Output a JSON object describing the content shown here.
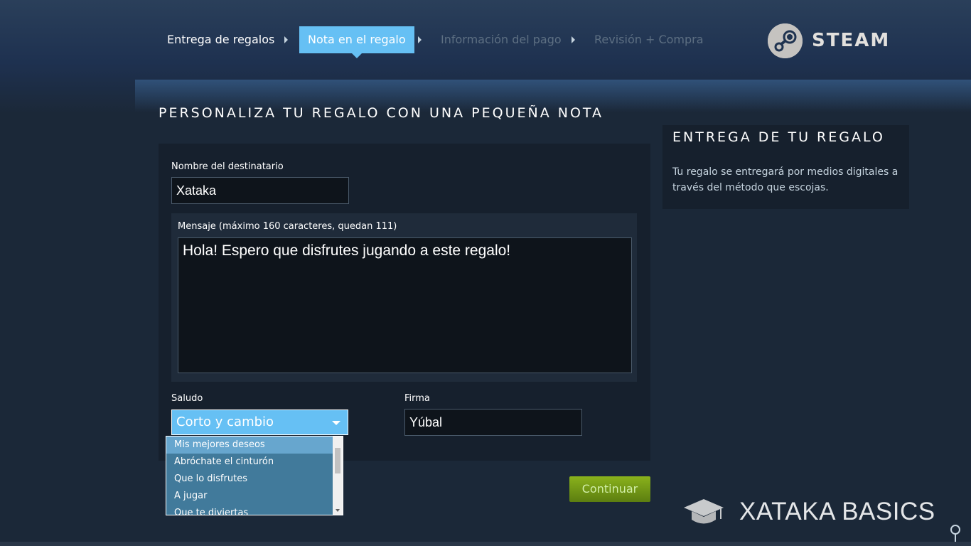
{
  "steps": [
    {
      "label": "Entrega de regalos",
      "state": "done"
    },
    {
      "label": "Nota en el regalo",
      "state": "active"
    },
    {
      "label": "Información del pago",
      "state": "todo"
    },
    {
      "label": "Revisión + Compra",
      "state": "todo"
    }
  ],
  "brand": {
    "name": "STEAM",
    "logo_icon": "steam-logo-icon"
  },
  "page_title": "PERSONALIZA TU REGALO CON UNA PEQUEÑA NOTA",
  "form": {
    "recipient_label": "Nombre del destinatario",
    "recipient_value": "Xataka",
    "message_label": "Mensaje (máximo 160 caracteres, quedan 111)",
    "message_value": "Hola! Espero que disfrutes jugando a este regalo!",
    "greeting_label": "Saludo",
    "greeting_value": "Corto y cambio",
    "greeting_options": [
      "Mis mejores deseos",
      "Abróchate el cinturón",
      "Que lo disfrutes",
      "A jugar",
      "Que te diviertas"
    ],
    "highlighted_option": "Mis mejores deseos",
    "signature_label": "Firma",
    "signature_value": "Yúbal",
    "continue_label": "Continuar"
  },
  "delivery": {
    "title": "ENTREGA DE TU REGALO",
    "text": "Tu regalo se entregará por medios digitales a través del método que escojas."
  },
  "watermark": {
    "text": "XATAKA BASICS",
    "icon": "graduation-cap-icon"
  },
  "colors": {
    "accent": "#66c0f4",
    "background": "#1b2838",
    "panel": "#16202d",
    "button_green": "#8ab21c"
  }
}
